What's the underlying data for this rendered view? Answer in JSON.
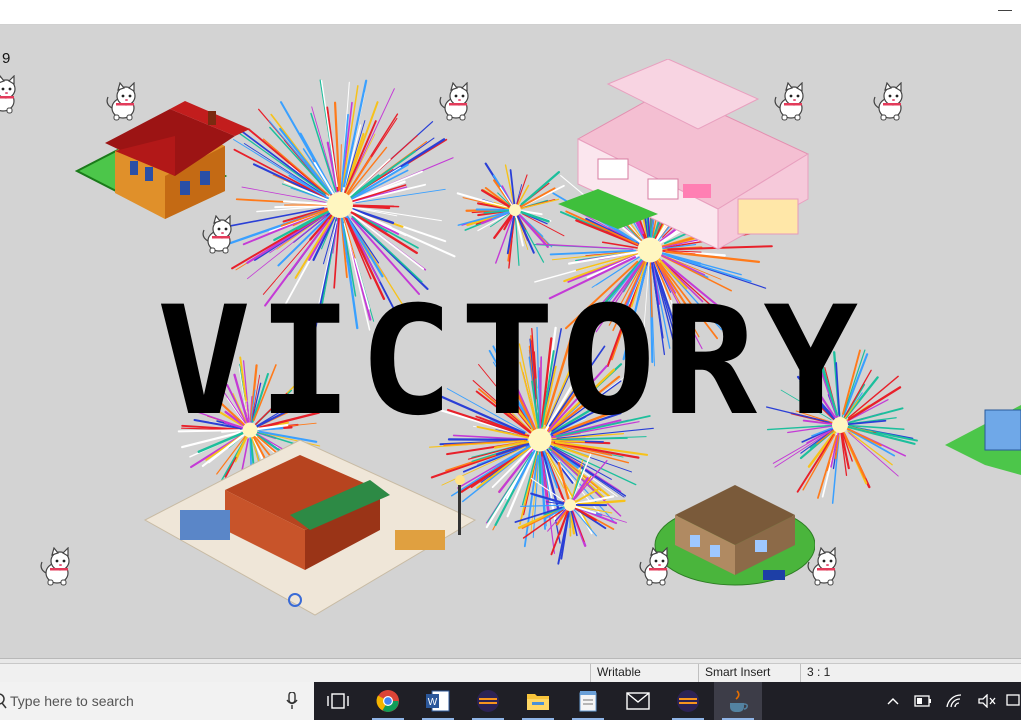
{
  "window": {
    "minimize_label": "—"
  },
  "game": {
    "counter": "9",
    "banner": "VICTORY",
    "colors": {
      "background": "#d3d3d3",
      "banner": "#000000"
    }
  },
  "status_bar": {
    "cells": [
      "Writable",
      "Smart Insert",
      "3 : 1"
    ]
  },
  "taskbar": {
    "search_placeholder": "Type here to search",
    "apps": [
      "task-view",
      "chrome",
      "word",
      "eclipse",
      "file-explorer",
      "notepad",
      "mail",
      "eclipse",
      "java"
    ],
    "tray": [
      "show-hidden-icons",
      "battery",
      "wifi",
      "volume-muted",
      "notifications"
    ]
  }
}
